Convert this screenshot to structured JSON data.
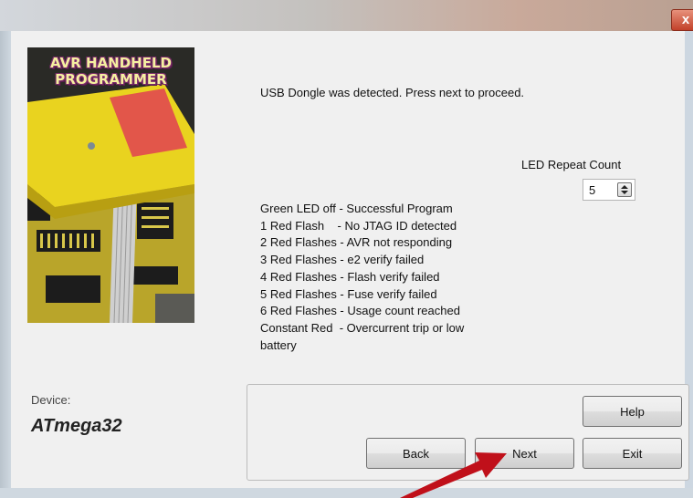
{
  "window": {
    "close_glyph": "x"
  },
  "banner": {
    "title_line1": "AVR HANDHELD",
    "title_line2": "PROGRAMMER"
  },
  "status_message": "USB Dongle was detected. Press next to proceed.",
  "led_repeat": {
    "label": "LED Repeat Count",
    "value": "5"
  },
  "led_codes": [
    "Green LED off - Successful Program",
    "1 Red Flash    - No JTAG ID detected",
    "2 Red Flashes - AVR not responding",
    "3 Red Flashes - e2 verify failed",
    "4 Red Flashes - Flash verify failed",
    "5 Red Flashes - Fuse verify failed",
    "6 Red Flashes - Usage count reached",
    "Constant Red  - Overcurrent trip or low",
    "battery"
  ],
  "device": {
    "label": "Device:",
    "name": "ATmega32"
  },
  "buttons": {
    "help": "Help",
    "back": "Back",
    "next": "Next",
    "exit": "Exit"
  },
  "colors": {
    "arrow": "#c0101a",
    "banner_yellow": "#e9d31f",
    "titlebar_close": "#c2412a"
  }
}
